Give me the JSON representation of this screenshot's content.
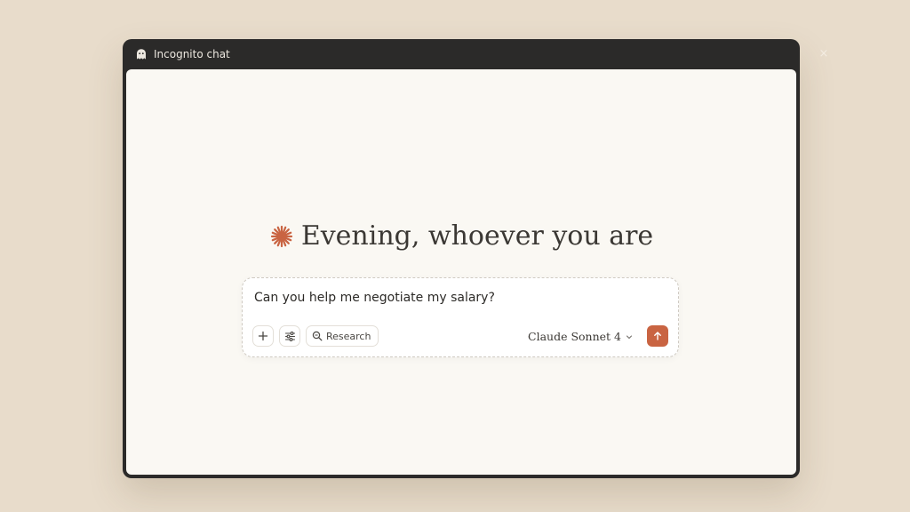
{
  "window": {
    "title": "Incognito chat",
    "close_label": "×"
  },
  "main": {
    "greeting": "Evening, whoever you are"
  },
  "composer": {
    "prompt_text": "Can you help me negotiate my salary?",
    "research_label": "Research",
    "model_label": "Claude Sonnet 4"
  },
  "icons": {
    "titlebar": "ghost-icon",
    "greeting": "sparkle-icon",
    "add": "plus-icon",
    "tools": "sliders-icon",
    "research": "search-zoom-icon",
    "model_dropdown": "chevron-down-icon",
    "send": "arrow-up-icon",
    "close": "close-icon"
  },
  "colors": {
    "background": "#e8dccb",
    "window_frame": "#2b2a29",
    "panel": "#faf8f3",
    "accent": "#c96442"
  }
}
